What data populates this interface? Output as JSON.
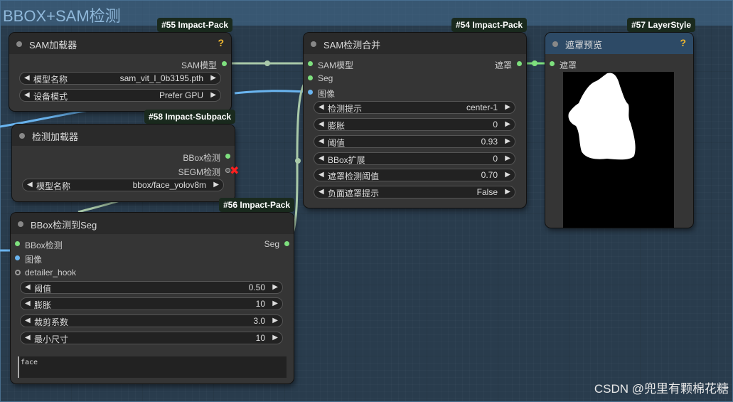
{
  "group": {
    "title": "BBOX+SAM检测"
  },
  "colors": {
    "image_wire": "#6ab5f0",
    "model_wire": "#a9c9a9",
    "green_slot": "#7ee07e",
    "blue_slot": "#6ab5f0",
    "help": "#f0b830",
    "error": "#ff2020"
  },
  "nodes": {
    "sam_loader": {
      "badge": "#55 Impact-Pack",
      "title": "SAM加载器",
      "help": "?",
      "out_sam": "SAM模型",
      "w_model_label": "模型名称",
      "w_model_value": "sam_vit_l_0b3195.pth",
      "w_device_label": "设备模式",
      "w_device_value": "Prefer GPU"
    },
    "det_loader": {
      "badge": "#58 Impact-Subpack",
      "title": "检测加载器",
      "out_bbox": "BBox检测",
      "out_segm": "SEGM检测",
      "w_model_label": "模型名称",
      "w_model_value": "bbox/face_yolov8m"
    },
    "bbox_to_seg": {
      "badge": "#56 Impact-Pack",
      "title": "BBox检测到Seg",
      "in_bbox": "BBox检测",
      "in_image": "图像",
      "in_hook": "detailer_hook",
      "out_seg": "Seg",
      "w_threshold_label": "阈值",
      "w_threshold_value": "0.50",
      "w_dilation_label": "膨胀",
      "w_dilation_value": "10",
      "w_crop_label": "裁剪系数",
      "w_crop_value": "3.0",
      "w_minsize_label": "最小尺寸",
      "w_minsize_value": "10",
      "text": "face"
    },
    "sam_detect": {
      "badge": "#54 Impact-Pack",
      "title": "SAM检测合并",
      "in_sam": "SAM模型",
      "in_seg": "Seg",
      "in_image": "图像",
      "out_mask": "遮罩",
      "w_hint_label": "检测提示",
      "w_hint_value": "center-1",
      "w_dilation_label": "膨胀",
      "w_dilation_value": "0",
      "w_threshold_label": "阈值",
      "w_threshold_value": "0.93",
      "w_bbox_label": "BBox扩展",
      "w_bbox_value": "0",
      "w_mask_label": "遮罩检测阈值",
      "w_mask_value": "0.70",
      "w_neg_label": "负面遮罩提示",
      "w_neg_value": "False"
    },
    "mask_preview": {
      "badge": "#57 LayerStyle",
      "title": "遮罩预览",
      "help": "?",
      "in_mask": "遮罩"
    }
  },
  "watermark": "CSDN @兜里有颗棉花糖"
}
